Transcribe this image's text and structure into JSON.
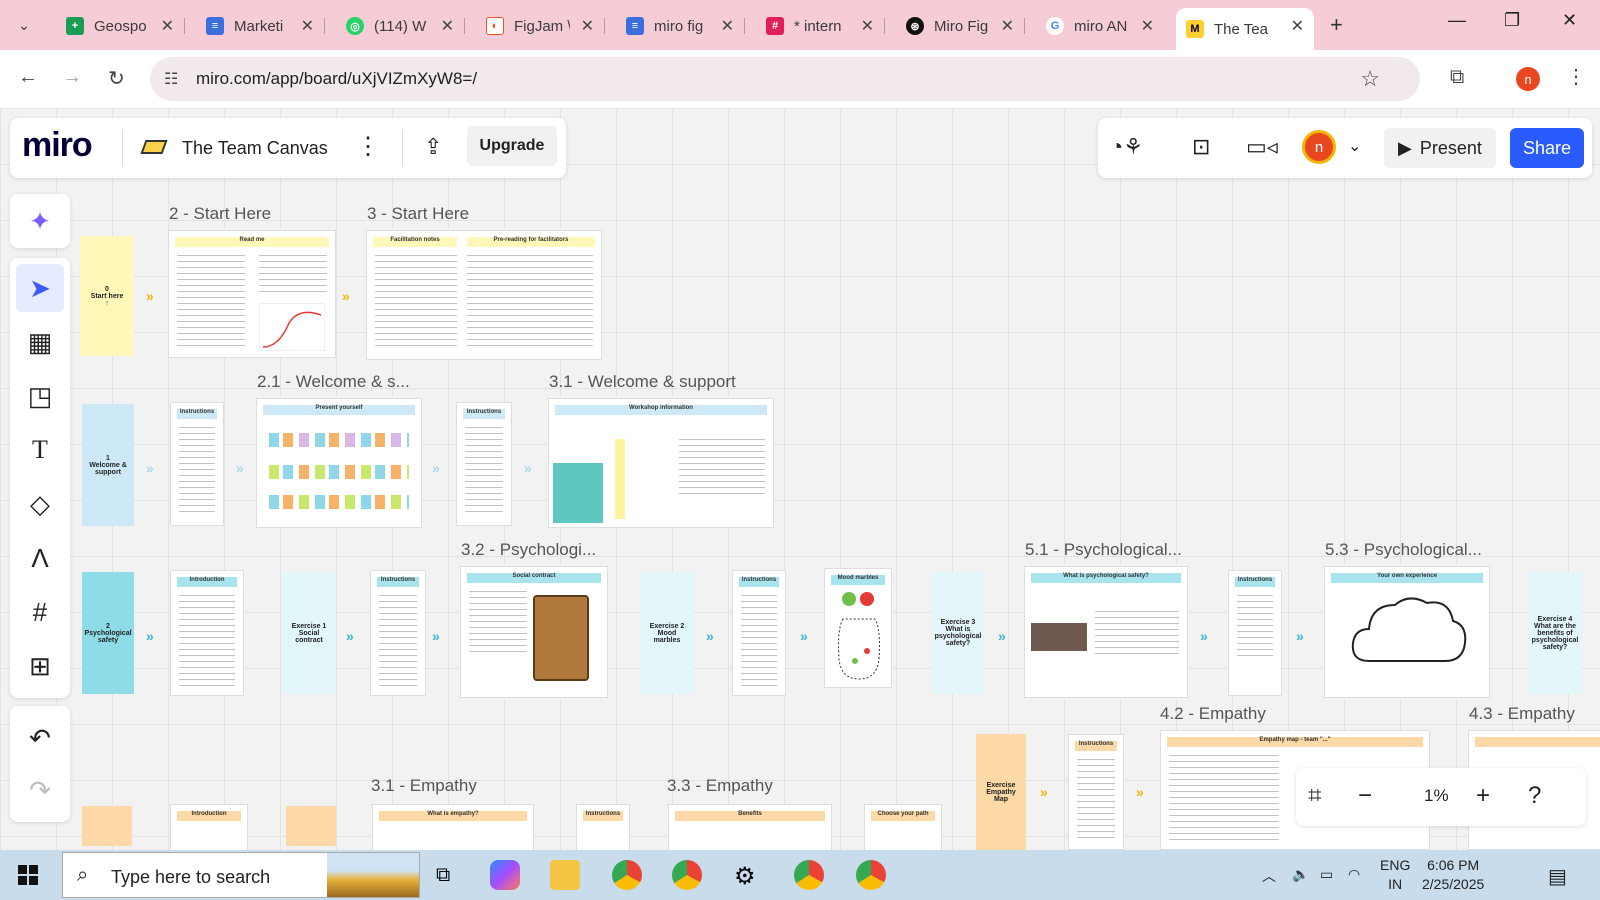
{
  "browser": {
    "tabs": [
      {
        "title": "Geospo",
        "fav_color": "#1a9c55",
        "fav_glyph": "+"
      },
      {
        "title": "Marketi",
        "fav_color": "#3b6fe0",
        "fav_glyph": "≡"
      },
      {
        "title": "(114) W",
        "fav_color": "#25d366",
        "fav_glyph": "◎"
      },
      {
        "title": "FigJam \\",
        "fav_color": "#f24e1e",
        "fav_glyph": "◐"
      },
      {
        "title": "miro fig",
        "fav_color": "#3b6fe0",
        "fav_glyph": "≡"
      },
      {
        "title": "* intern",
        "fav_color": "#e01e5a",
        "fav_glyph": "#"
      },
      {
        "title": "Miro Fig",
        "fav_color": "#111111",
        "fav_glyph": "⊛"
      },
      {
        "title": "miro AN",
        "fav_color": "#4285f4",
        "fav_glyph": "G"
      },
      {
        "title": "The Tea",
        "fav_color": "#ffd02f",
        "fav_glyph": "M"
      }
    ],
    "url": "miro.com/app/board/uXjVIZmXyW8=/"
  },
  "miro": {
    "logo": "miro",
    "board_title": "The Team Canvas",
    "upgrade_label": "Upgrade",
    "present_label": "Present",
    "share_label": "Share",
    "user_initial": "n",
    "zoom_level": "1%"
  },
  "frames": {
    "labels": {
      "f2": "2 - Start Here",
      "f3": "3 - Start Here",
      "f21": "2.1 - Welcome & s...",
      "f31": "3.1 - Welcome & support",
      "f32": "3.2 - Psychologi...",
      "f51": "5.1 - Psychological...",
      "f53": "5.3 - Psychological...",
      "f42": "4.2 - Empathy",
      "f43": "4.3 - Empathy",
      "f31e": "3.1 - Empathy",
      "f33e": "3.3 - Empathy"
    },
    "cards": {
      "start_here": "0\nStart here\n↑",
      "welcome": "1\nWelcome &\nsupport",
      "psych": "2\nPsychological\nsafety",
      "ex1": "Exercise 1\nSocial\ncontract",
      "ex2": "Exercise 2\nMood\nmarbles",
      "ex3": "Exercise 3\nWhat is\npsychological\nsafety?",
      "ex4": "Exercise 4\nWhat are the\nbenefits of\npsychological\nsafety?",
      "empathy_map": "Exercise\nEmpathy\nMap"
    },
    "headers": {
      "read_me": "Read me",
      "facilitation": "Facilitation notes",
      "prereading": "Pre-reading for facilitators",
      "instructions": "Instructions",
      "present_yourself": "Present yourself",
      "workshop_info": "Workshop information",
      "introduction": "Introduction",
      "social_contract": "Social contract",
      "mood_marbles": "Mood marbles",
      "what_is_ps": "What is psychological safety?",
      "own_experience": "Your own experience",
      "empathy_team": "Empathy map - team \"...\"",
      "what_is_empathy": "What is empathy?",
      "benefits": "Benefits",
      "choose_path": "Choose your path"
    }
  },
  "taskbar": {
    "search_placeholder": "Type here to search",
    "lang_top": "ENG",
    "lang_bottom": "IN",
    "time": "6:06 PM",
    "date": "2/25/2025"
  }
}
